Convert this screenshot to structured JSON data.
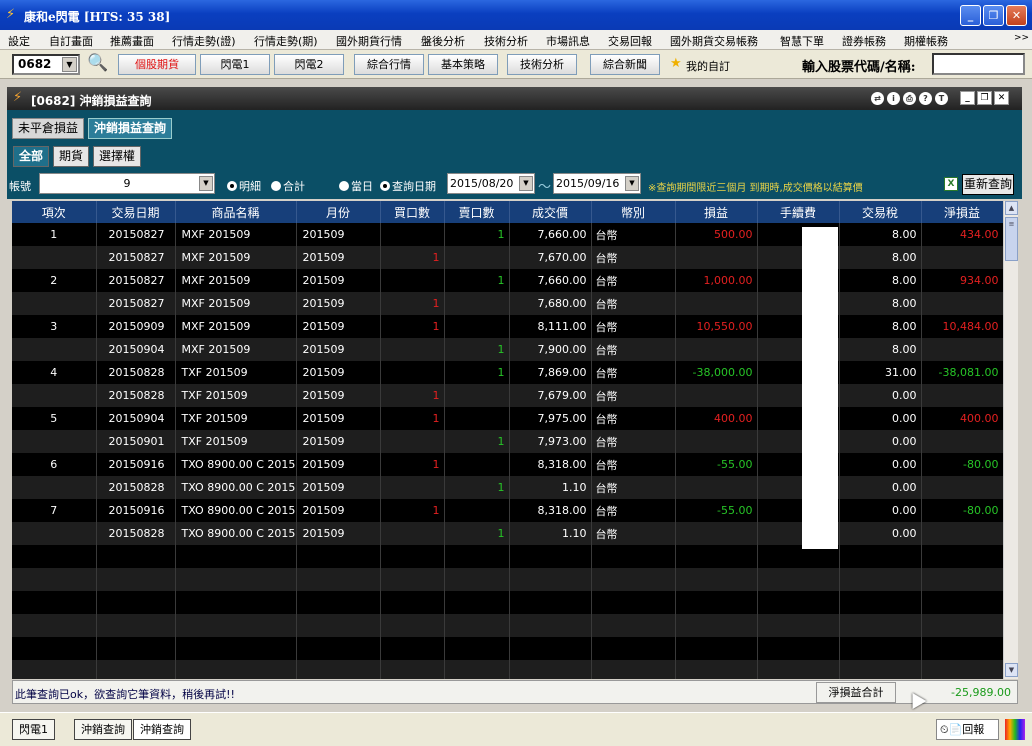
{
  "window": {
    "title": "康和e閃電 [HTS: 35 38]"
  },
  "menu": [
    "設定",
    "自訂畫面",
    "推薦畫面",
    "行情走勢(證)",
    "行情走勢(期)",
    "國外期貨行情",
    "盤後分析",
    "技術分析",
    "市場訊息",
    "交易回報",
    "國外期貨交易帳務",
    "智慧下單",
    "證券帳務",
    "期權帳務"
  ],
  "menu_more": ">>",
  "toolbar": {
    "code": "0682",
    "buttons": [
      "個股期貨",
      "閃電1",
      "閃電2",
      "綜合行情",
      "基本策略",
      "技術分析",
      "綜合新聞"
    ],
    "my_custom": "我的自訂",
    "stock_label": "輸入股票代碼/名稱:"
  },
  "panel": {
    "title": "[0682] 沖銷損益查詢"
  },
  "tabs_top": [
    "未平倉損益",
    "沖銷損益查詢"
  ],
  "tabs_sub": [
    "全部",
    "期貨",
    "選擇權"
  ],
  "filter": {
    "account_label": "帳號",
    "account_value": "9",
    "detail": "明細",
    "total": "合計",
    "today": "當日",
    "query_date": "查詢日期",
    "date_from": "2015/08/20",
    "tilde": "～",
    "date_to": "2015/09/16",
    "note": "※查詢期間限近三個月  到期時,成交價格以結算價",
    "refresh": "重新查詢"
  },
  "table": {
    "columns": [
      "項次",
      "交易日期",
      "商品名稱",
      "月份",
      "買口數",
      "賣口數",
      "成交價",
      "幣別",
      "損益",
      "手續費",
      "交易稅",
      "淨損益"
    ],
    "rows": [
      [
        "1",
        "20150827",
        "MXF 201509",
        "201509",
        "",
        "1",
        "7,660.00",
        "台幣",
        "500.00",
        "",
        "8.00",
        "434.00"
      ],
      [
        "",
        "20150827",
        "MXF 201509",
        "201509",
        "1",
        "",
        "7,670.00",
        "台幣",
        "",
        "",
        "8.00",
        ""
      ],
      [
        "2",
        "20150827",
        "MXF 201509",
        "201509",
        "",
        "1",
        "7,660.00",
        "台幣",
        "1,000.00",
        "",
        "8.00",
        "934.00"
      ],
      [
        "",
        "20150827",
        "MXF 201509",
        "201509",
        "1",
        "",
        "7,680.00",
        "台幣",
        "",
        "",
        "8.00",
        ""
      ],
      [
        "3",
        "20150909",
        "MXF 201509",
        "201509",
        "1",
        "",
        "8,111.00",
        "台幣",
        "10,550.00",
        "",
        "8.00",
        "10,484.00"
      ],
      [
        "",
        "20150904",
        "MXF 201509",
        "201509",
        "",
        "1",
        "7,900.00",
        "台幣",
        "",
        "",
        "8.00",
        ""
      ],
      [
        "4",
        "20150828",
        "TXF 201509",
        "201509",
        "",
        "1",
        "7,869.00",
        "台幣",
        "-38,000.00",
        "",
        "31.00",
        "-38,081.00"
      ],
      [
        "",
        "20150828",
        "TXF 201509",
        "201509",
        "1",
        "",
        "7,679.00",
        "台幣",
        "",
        "",
        "0.00",
        ""
      ],
      [
        "5",
        "20150904",
        "TXF 201509",
        "201509",
        "1",
        "",
        "7,975.00",
        "台幣",
        "400.00",
        "",
        "0.00",
        "400.00"
      ],
      [
        "",
        "20150901",
        "TXF 201509",
        "201509",
        "",
        "1",
        "7,973.00",
        "台幣",
        "",
        "",
        "0.00",
        ""
      ],
      [
        "6",
        "20150916",
        "TXO 8900.00 C 2015",
        "201509",
        "1",
        "",
        "8,318.00",
        "台幣",
        "-55.00",
        "",
        "0.00",
        "-80.00"
      ],
      [
        "",
        "20150828",
        "TXO 8900.00 C 2015",
        "201509",
        "",
        "1",
        "1.10",
        "台幣",
        "",
        "",
        "0.00",
        ""
      ],
      [
        "7",
        "20150916",
        "TXO 8900.00 C 2015",
        "201509",
        "1",
        "",
        "8,318.00",
        "台幣",
        "-55.00",
        "",
        "0.00",
        "-80.00"
      ],
      [
        "",
        "20150828",
        "TXO 8900.00 C 2015",
        "201509",
        "",
        "1",
        "1.10",
        "台幣",
        "",
        "",
        "0.00",
        ""
      ]
    ],
    "empty_rows": 6
  },
  "status": {
    "message": "此筆查詢已ok，欲查詢它筆資料，稍後再試!!",
    "total_label": "淨損益合計",
    "total_value": "-25,989.00"
  },
  "taskbar": {
    "items": [
      "閃電1",
      "沖銷查詢",
      "沖銷查詢"
    ],
    "tray": "回報"
  },
  "colors": {
    "grid_bg": "#000000",
    "header_bg": "#173f7a",
    "panel_bg": "#0b4f66",
    "positive": "#e32020",
    "negative": "#27c427"
  }
}
